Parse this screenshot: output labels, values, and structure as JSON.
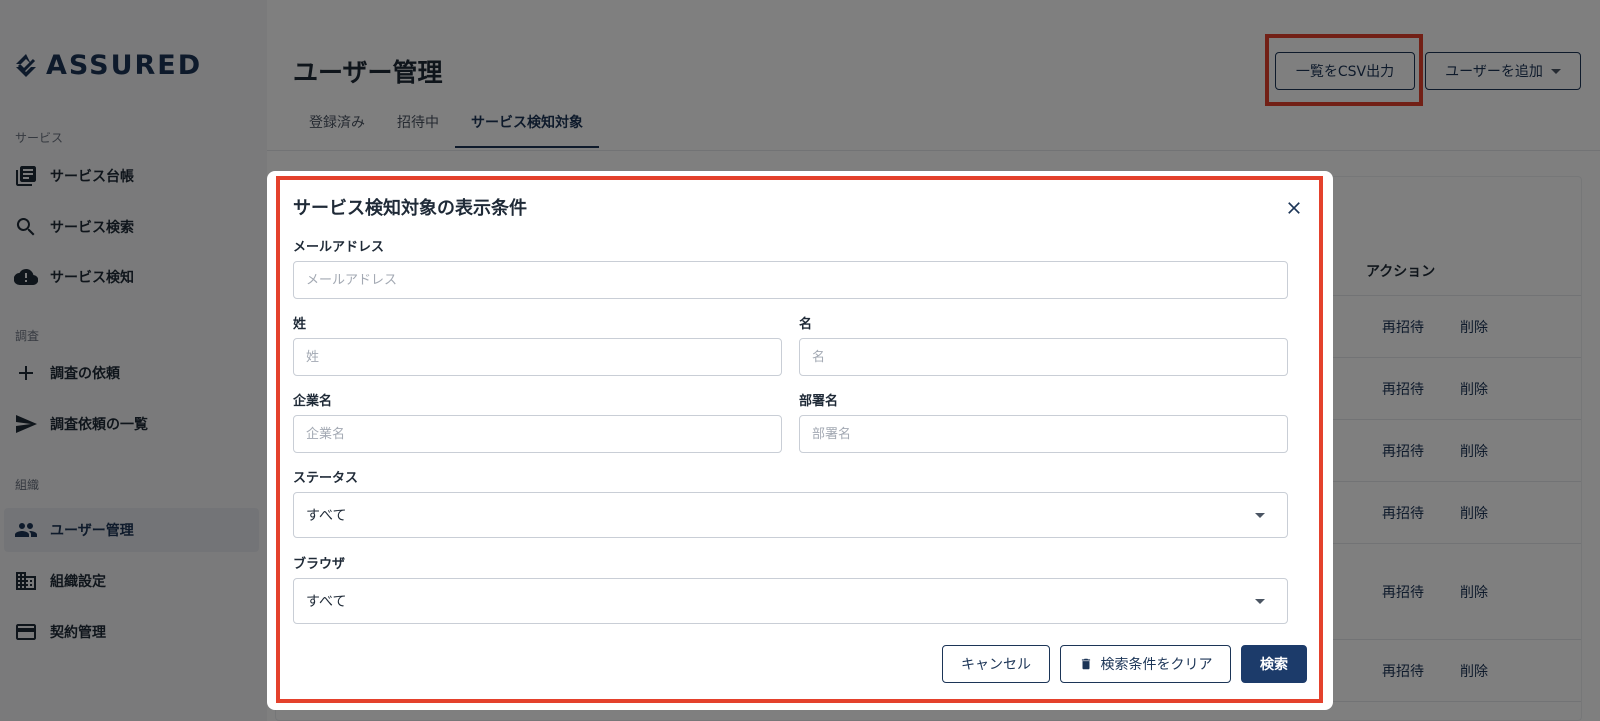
{
  "logo": {
    "text": "ASSURED"
  },
  "sidebar": {
    "sections": [
      {
        "label": "サービス"
      },
      {
        "label": "調査"
      },
      {
        "label": "組織"
      }
    ],
    "items": [
      {
        "label": "サービス台帳",
        "icon": "library-icon"
      },
      {
        "label": "サービス検索",
        "icon": "search-icon"
      },
      {
        "label": "サービス検知",
        "icon": "cloud-alert-icon"
      },
      {
        "label": "調査の依頼",
        "icon": "plus-icon"
      },
      {
        "label": "調査依頼の一覧",
        "icon": "send-icon"
      },
      {
        "label": "ユーザー管理",
        "icon": "people-icon",
        "active": true
      },
      {
        "label": "組織設定",
        "icon": "building-icon"
      },
      {
        "label": "契約管理",
        "icon": "credit-card-icon"
      }
    ]
  },
  "header": {
    "title": "ユーザー管理",
    "csv_button": "一覧をCSV出力",
    "add_user_button": "ユーザーを追加"
  },
  "tabs": [
    {
      "label": "登録済み"
    },
    {
      "label": "招待中"
    },
    {
      "label": "サービス検知対象",
      "active": true
    }
  ],
  "table": {
    "action_header": "アクション",
    "rows": [
      {
        "reinvite": "再招待",
        "delete": "削除"
      },
      {
        "reinvite": "再招待",
        "delete": "削除"
      },
      {
        "reinvite": "再招待",
        "delete": "削除"
      },
      {
        "reinvite": "再招待",
        "delete": "削除"
      },
      {
        "reinvite": "再招待",
        "delete": "削除"
      },
      {
        "reinvite": "再招待",
        "delete": "削除"
      }
    ]
  },
  "modal": {
    "title": "サービス検知対象の表示条件",
    "email": {
      "label": "メールアドレス",
      "placeholder": "メールアドレス",
      "value": ""
    },
    "last_name": {
      "label": "姓",
      "placeholder": "姓",
      "value": ""
    },
    "first_name": {
      "label": "名",
      "placeholder": "名",
      "value": ""
    },
    "company": {
      "label": "企業名",
      "placeholder": "企業名",
      "value": ""
    },
    "department": {
      "label": "部署名",
      "placeholder": "部署名",
      "value": ""
    },
    "status": {
      "label": "ステータス",
      "selected": "すべて"
    },
    "browser": {
      "label": "ブラウザ",
      "selected": "すべて"
    },
    "cancel_button": "キャンセル",
    "clear_button": "検索条件をクリア",
    "search_button": "検索"
  },
  "colors": {
    "brand": "#1c3557",
    "primary_button": "#1c3b6a",
    "highlight": "#e4412c",
    "overlay": "rgba(0,0,0,0.5)"
  }
}
